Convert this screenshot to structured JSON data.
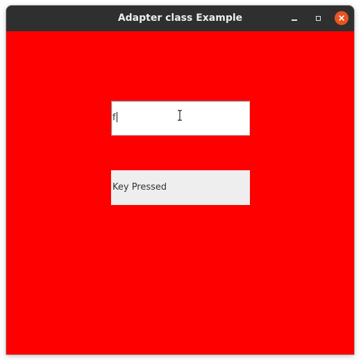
{
  "window": {
    "title": "Adapter class Example",
    "controls": {
      "minimize_icon": "minimize-icon",
      "maximize_icon": "maximize-icon",
      "close_icon": "close-icon"
    },
    "colors": {
      "titlebar": "#2f2f2f",
      "background": "#ff0000",
      "close_button": "#e95420"
    }
  },
  "form": {
    "text_field": {
      "value": "f"
    },
    "status_label": {
      "text": "Key Pressed"
    }
  }
}
